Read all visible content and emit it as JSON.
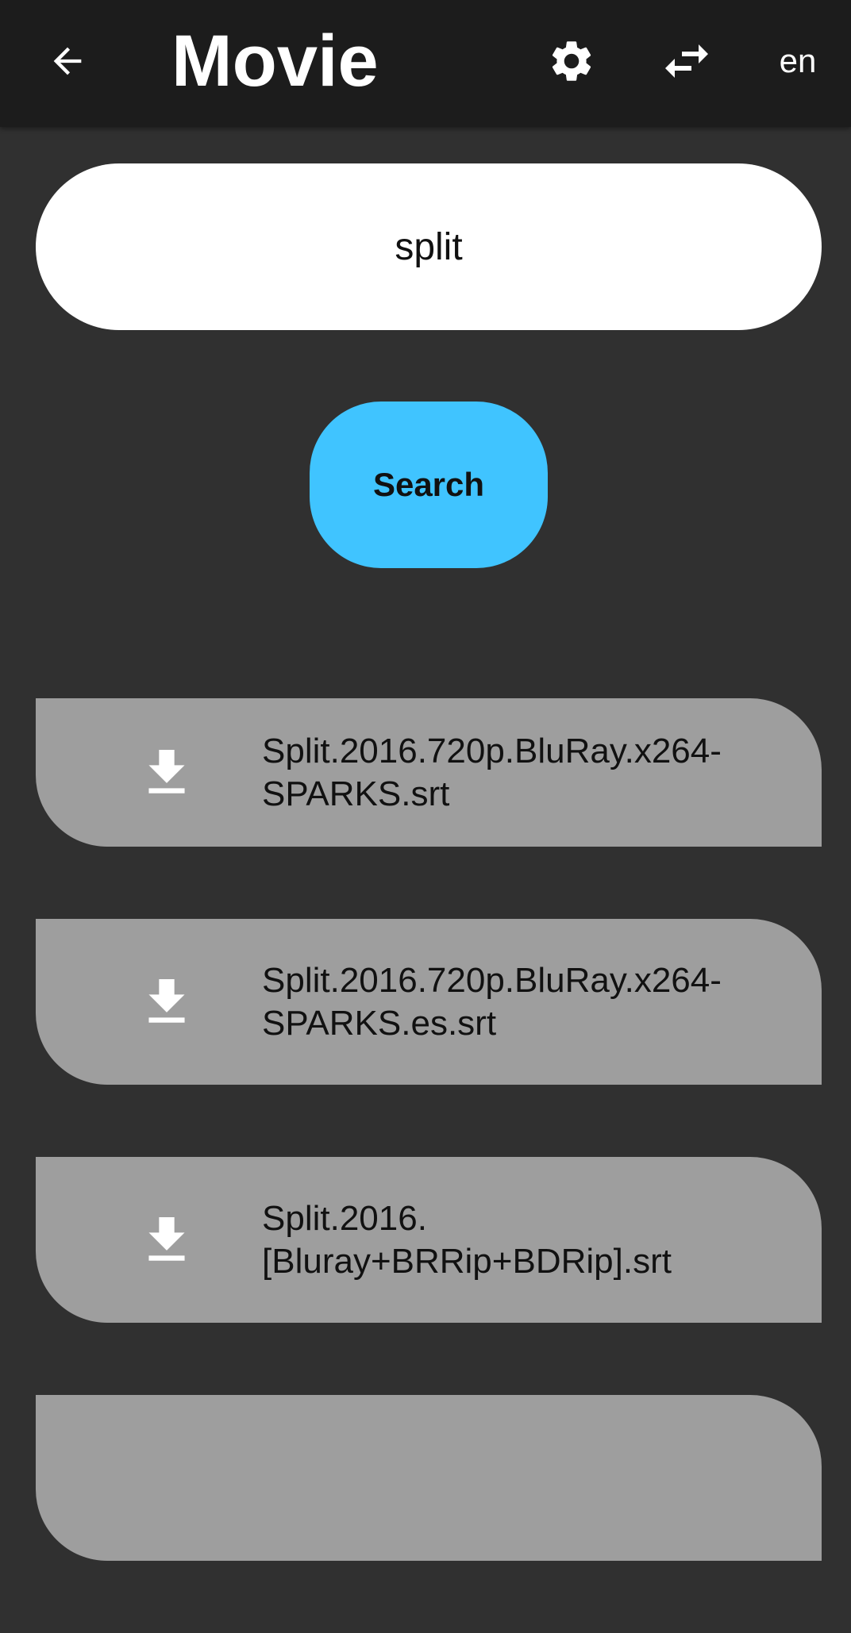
{
  "appbar": {
    "title": "Movie",
    "back_icon": "arrow-back-icon",
    "settings_icon": "gear-icon",
    "swap_icon": "swap-horiz-icon",
    "language": "en"
  },
  "search": {
    "query": "split",
    "button_label": "Search"
  },
  "results": [
    {
      "name": "Split.2016.720p.BluRay.x264-SPARKS.srt",
      "icon": "download-icon"
    },
    {
      "name": "Split.2016.720p.BluRay.x264-SPARKS.es.srt",
      "icon": "download-icon"
    },
    {
      "name": "Split.2016.[Bluray+BRRip+BDRip].srt",
      "icon": "download-icon"
    },
    {
      "name": "",
      "icon": ""
    }
  ],
  "colors": {
    "background": "#303030",
    "appbar": "#1c1c1c",
    "accent": "#40c4ff",
    "card": "#9e9e9e"
  }
}
